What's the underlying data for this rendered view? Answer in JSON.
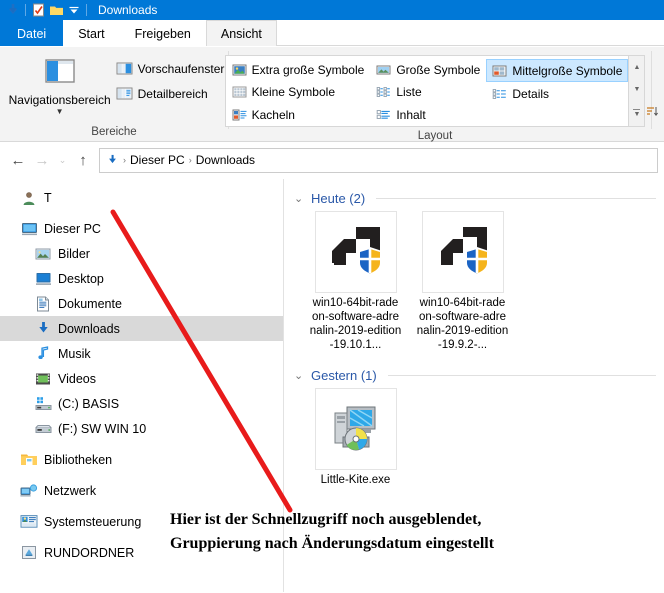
{
  "titlebar": {
    "title": "Downloads",
    "icons": [
      "download-arrow-icon",
      "properties-icon",
      "new-folder-icon",
      "customize-quick-access-chevron-icon"
    ]
  },
  "tabs": [
    {
      "label": "Datei",
      "state": "file-menu"
    },
    {
      "label": "Start",
      "state": "inactive"
    },
    {
      "label": "Freigeben",
      "state": "inactive"
    },
    {
      "label": "Ansicht",
      "state": "active"
    }
  ],
  "ribbon": {
    "groups": [
      {
        "name": "Bereiche",
        "label": "Bereiche",
        "big_button": {
          "label": "Navigationsbereich",
          "icon": "navigation-pane-icon",
          "has_dropdown": true
        },
        "small_buttons": [
          {
            "label": "Vorschaufenster",
            "icon": "preview-pane-icon"
          },
          {
            "label": "Detailbereich",
            "icon": "details-pane-icon"
          }
        ]
      },
      {
        "name": "Layout",
        "label": "Layout",
        "items": [
          {
            "label": "Extra große Symbole",
            "icon": "extra-large-icons-icon",
            "selected": false
          },
          {
            "label": "Kleine Symbole",
            "icon": "small-icons-icon",
            "selected": false
          },
          {
            "label": "Kacheln",
            "icon": "tiles-icon",
            "selected": false
          },
          {
            "label": "Große Symbole",
            "icon": "large-icons-icon",
            "selected": false
          },
          {
            "label": "Liste",
            "icon": "list-icon",
            "selected": false
          },
          {
            "label": "Inhalt",
            "icon": "content-icon",
            "selected": false
          },
          {
            "label": "Mittelgroße Symbole",
            "icon": "medium-icons-icon",
            "selected": true
          },
          {
            "label": "Details",
            "icon": "details-icon",
            "selected": false
          }
        ],
        "scroll_up": "▲",
        "scroll_down": "▼",
        "scroll_more": "▼"
      }
    ]
  },
  "addressbar": {
    "back": "←",
    "forward": "→",
    "recent": "⌄",
    "up": "↑",
    "location_icon": "download-arrow-icon",
    "crumbs": [
      "Dieser PC",
      "Downloads"
    ],
    "separator": "›"
  },
  "sidebar": {
    "items": [
      {
        "label": "T",
        "icon": "user-account-icon",
        "level": 0,
        "selected": false,
        "gap_before": false
      },
      {
        "label": "Dieser PC",
        "icon": "this-pc-icon",
        "level": 0,
        "selected": false,
        "gap_before": true
      },
      {
        "label": "Bilder",
        "icon": "pictures-icon",
        "level": 1,
        "selected": false,
        "gap_before": false
      },
      {
        "label": "Desktop",
        "icon": "desktop-icon",
        "level": 1,
        "selected": false,
        "gap_before": false
      },
      {
        "label": "Dokumente",
        "icon": "documents-icon",
        "level": 1,
        "selected": false,
        "gap_before": false
      },
      {
        "label": "Downloads",
        "icon": "downloads-icon",
        "level": 1,
        "selected": true,
        "gap_before": false
      },
      {
        "label": "Musik",
        "icon": "music-icon",
        "level": 1,
        "selected": false,
        "gap_before": false
      },
      {
        "label": "Videos",
        "icon": "videos-icon",
        "level": 1,
        "selected": false,
        "gap_before": false
      },
      {
        "label": "(C:) BASIS",
        "icon": "local-disk-icon",
        "level": 1,
        "selected": false,
        "gap_before": false
      },
      {
        "label": "(F:) SW WIN 10",
        "icon": "hard-disk-icon",
        "level": 1,
        "selected": false,
        "gap_before": false
      },
      {
        "label": "Bibliotheken",
        "icon": "libraries-icon",
        "level": 0,
        "selected": false,
        "gap_before": true
      },
      {
        "label": "Netzwerk",
        "icon": "network-icon",
        "level": 0,
        "selected": false,
        "gap_before": true
      },
      {
        "label": "Systemsteuerung",
        "icon": "control-panel-icon",
        "level": 0,
        "selected": false,
        "gap_before": true
      },
      {
        "label": "RUNDORDNER",
        "icon": "folder-shortcut-icon",
        "level": 0,
        "selected": false,
        "gap_before": true
      }
    ]
  },
  "filepane": {
    "groups": [
      {
        "title": "Heute (2)",
        "chevron": "⌄",
        "files": [
          {
            "name": "win10-64bit-radeon-software-adrenalin-2019-edition-19.10.1...",
            "icon": "amd-installer-icon"
          },
          {
            "name": "win10-64bit-radeon-software-adrenalin-2019-edition-19.9.2-...",
            "icon": "amd-installer-icon"
          }
        ]
      },
      {
        "title": "Gestern (1)",
        "chevron": "⌄",
        "files": [
          {
            "name": "Little-Kite.exe",
            "icon": "setup-program-icon"
          }
        ]
      }
    ]
  },
  "annotation": {
    "line1": "Hier ist der Schnellzugriff noch ausgeblendet,",
    "line2": "Gruppierung nach Änderungsdatum eingestellt",
    "arrow_color": "#e81b1b"
  },
  "colors": {
    "titlebar": "#0078d7",
    "ribbon_bg": "#f3f3f3",
    "selection": "#d9d9d9",
    "gallery_selection": "#cce8ff",
    "group_title": "#2a58a8",
    "annotation_red": "#e81b1b"
  }
}
